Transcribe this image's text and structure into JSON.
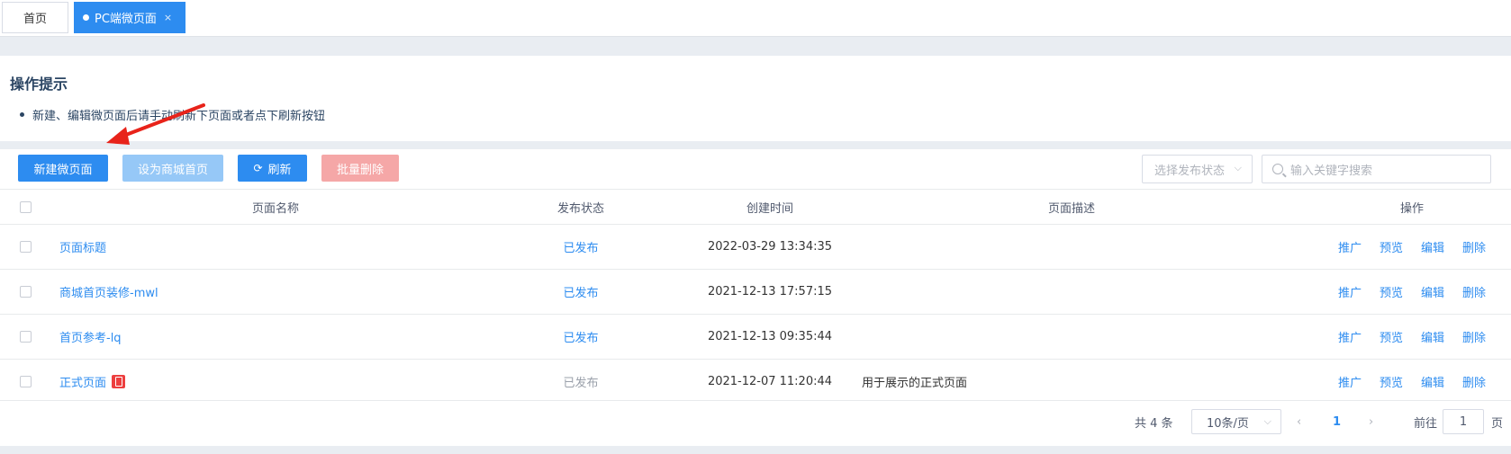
{
  "tabs": {
    "home": "首页",
    "active": "PC端微页面",
    "close": "×"
  },
  "tips": {
    "title": "操作提示",
    "items": [
      "新建、编辑微页面后请手动刷新下页面或者点下刷新按钮"
    ]
  },
  "toolbar": {
    "new_label": "新建微页面",
    "set_home_label": "设为商城首页",
    "refresh_label": "刷新",
    "batch_delete_label": "批量删除",
    "status_select_placeholder": "选择发布状态",
    "search_placeholder": "输入关键字搜索"
  },
  "table": {
    "headers": {
      "name": "页面名称",
      "status": "发布状态",
      "created": "创建时间",
      "desc": "页面描述",
      "ops": "操作"
    },
    "rows": [
      {
        "name": "页面标题",
        "status": "已发布",
        "created": "2022-03-29 13:34:35",
        "desc": ""
      },
      {
        "name": "商城首页装修-mwl",
        "status": "已发布",
        "created": "2021-12-13 17:57:15",
        "desc": ""
      },
      {
        "name": "首页参考-lq",
        "status": "已发布",
        "created": "2021-12-13 09:35:44",
        "desc": ""
      },
      {
        "name": "正式页面",
        "status": "已发布",
        "created": "2021-12-07 11:20:44",
        "desc": "用于展示的正式页面"
      }
    ],
    "ops": [
      "推广",
      "预览",
      "编辑",
      "删除"
    ]
  },
  "pager": {
    "total": "共 4 条",
    "page_size": "10条/页",
    "prev": "‹",
    "current": "1",
    "next": "›",
    "goto_label": "前往",
    "goto_value": "1",
    "goto_unit": "页"
  },
  "colors": {
    "primary": "#2d8cf0",
    "danger_light": "#f5a7a7",
    "primary_light": "#96c8f7",
    "badge": "#ed3f3f",
    "arrow": "#e8231a"
  },
  "icons": {
    "refresh": "refresh-icon",
    "search": "search-icon",
    "dropdown": "chevron-down-icon",
    "mobile_badge": "mobile-page-icon"
  }
}
